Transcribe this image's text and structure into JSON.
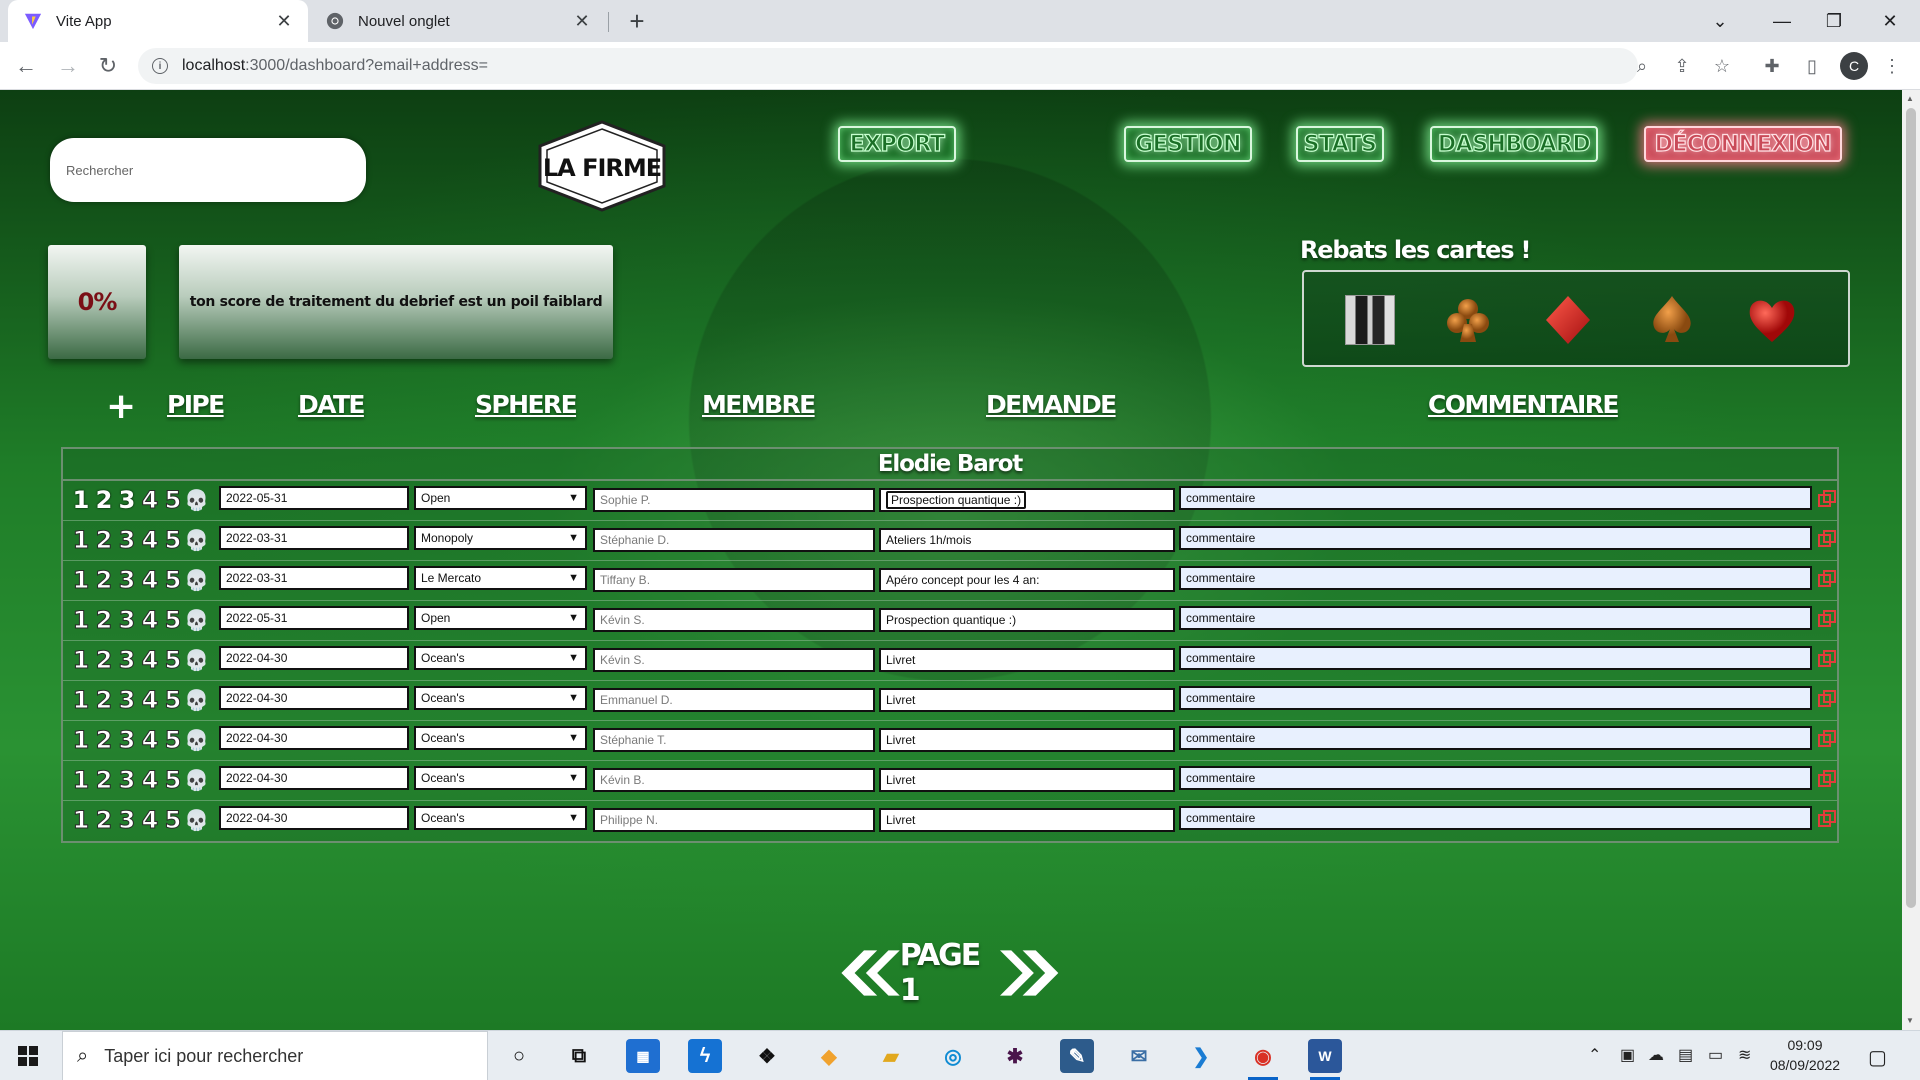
{
  "browser": {
    "tabs": [
      {
        "title": "Vite App",
        "active": true,
        "icon": "vite-icon"
      },
      {
        "title": "Nouvel onglet",
        "active": false,
        "icon": "chrome-icon"
      }
    ],
    "url_host": "localhost",
    "url_path": ":3000/dashboard?email+address=",
    "profile_initial": "C"
  },
  "header": {
    "search_placeholder": "Rechercher",
    "logo_text": "LA FIRME",
    "buttons": {
      "export": "EXPORT",
      "gestion": "GESTION",
      "stats": "STATS",
      "dashboard": "DASHBOARD",
      "logout": "DÉCONNEXION"
    }
  },
  "score": {
    "value": "0%",
    "message": "ton score de traitement du debrief est un poil faiblard"
  },
  "cards": {
    "title": "Rebats les cartes !",
    "items": [
      "photo",
      "club-icon",
      "diamond-icon",
      "spade-icon",
      "heart-icon"
    ]
  },
  "columns": {
    "add": "+",
    "pipe": "PIPE",
    "date": "DATE",
    "sphere": "SPHERE",
    "member": "MEMBRE",
    "request": "DEMANDE",
    "comment": "COMMENTAIRE"
  },
  "group": {
    "name": "Elodie Barot",
    "stage_labels": [
      "1",
      "2",
      "3",
      "4",
      "5"
    ],
    "rows": [
      {
        "stage": 3,
        "date": "2022-05-31",
        "sphere": "Open",
        "member": "Sophie P.",
        "request": "Prospection quantique :)",
        "comment": "commentaire",
        "focused": true
      },
      {
        "stage": 0,
        "date": "2022-03-31",
        "sphere": "Monopoly",
        "member": "Stéphanie D.",
        "request": "Ateliers 1h/mois",
        "comment": "commentaire",
        "focused": false
      },
      {
        "stage": 0,
        "date": "2022-03-31",
        "sphere": "Le Mercato",
        "member": "Tiffany B.",
        "request": "Apéro concept pour les 4 an:",
        "comment": "commentaire",
        "focused": false
      },
      {
        "stage": 0,
        "date": "2022-05-31",
        "sphere": "Open",
        "member": "Kévin S.",
        "request": "Prospection quantique :)",
        "comment": "commentaire",
        "focused": false
      },
      {
        "stage": 0,
        "date": "2022-04-30",
        "sphere": "Ocean's",
        "member": "Kévin S.",
        "request": "Livret",
        "comment": "commentaire",
        "focused": false
      },
      {
        "stage": 0,
        "date": "2022-04-30",
        "sphere": "Ocean's",
        "member": "Emmanuel D.",
        "request": "Livret",
        "comment": "commentaire",
        "focused": false
      },
      {
        "stage": 0,
        "date": "2022-04-30",
        "sphere": "Ocean's",
        "member": "Stéphanie T.",
        "request": "Livret",
        "comment": "commentaire",
        "focused": false
      },
      {
        "stage": 0,
        "date": "2022-04-30",
        "sphere": "Ocean's",
        "member": "Kévin B.",
        "request": "Livret",
        "comment": "commentaire",
        "focused": false
      },
      {
        "stage": 0,
        "date": "2022-04-30",
        "sphere": "Ocean's",
        "member": "Philippe N.",
        "request": "Livret",
        "comment": "commentaire",
        "focused": false
      }
    ]
  },
  "pager": {
    "label": "PAGE 1"
  },
  "taskbar": {
    "search_placeholder": "Taper ici pour rechercher",
    "time": "09:09",
    "date": "08/09/2022"
  },
  "colors": {
    "felt": "#1f7d28",
    "neon_green": "#8cffa0",
    "neon_red": "#ff788c",
    "score_red": "#7a0f16"
  }
}
